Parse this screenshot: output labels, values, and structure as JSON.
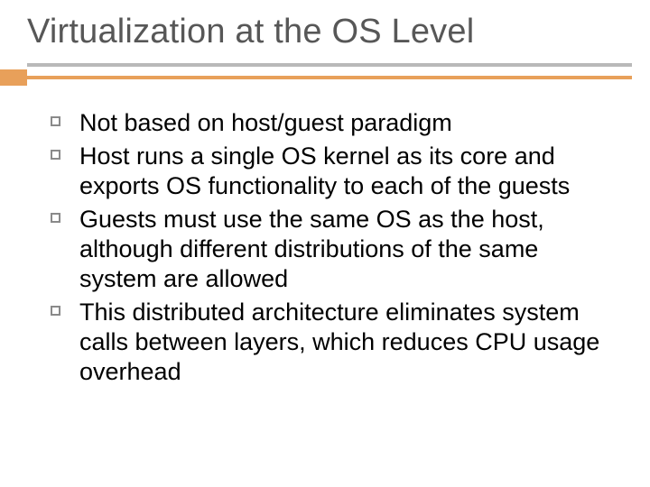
{
  "title": "Virtualization at the OS Level",
  "bullets": [
    "Not based on host/guest paradigm",
    "Host runs a single OS kernel as its core and exports OS functionality to each of the guests",
    "Guests must use the same OS as the host, although different distributions of the same system are allowed",
    "This distributed architecture eliminates system calls between layers, which reduces CPU usage overhead"
  ]
}
